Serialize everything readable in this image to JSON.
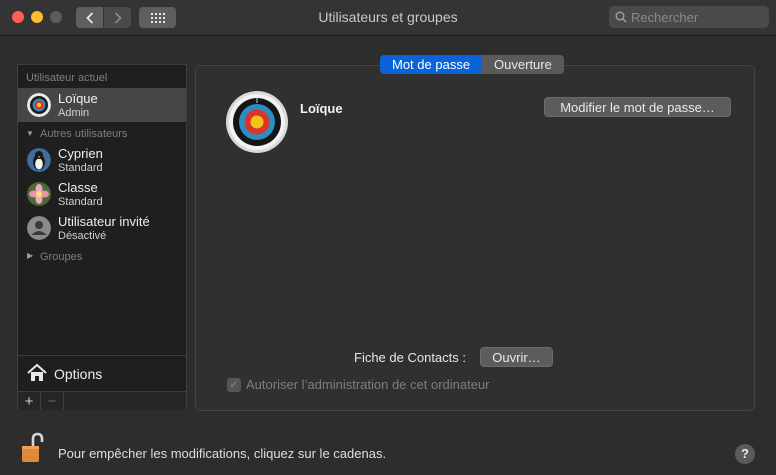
{
  "window": {
    "title": "Utilisateurs et groupes"
  },
  "toolbar": {
    "search_placeholder": "Rechercher",
    "back_icon": "chevron-left-icon",
    "forward_icon": "chevron-right-icon",
    "grid_icon": "grid-icon"
  },
  "sidebar": {
    "current_label": "Utilisateur actuel",
    "current_user": {
      "name": "Loïque",
      "role": "Admin"
    },
    "others_label": "Autres utilisateurs",
    "others": [
      {
        "name": "Cyprien",
        "role": "Standard"
      },
      {
        "name": "Classe",
        "role": "Standard"
      },
      {
        "name": "Utilisateur invité",
        "role": "Désactivé"
      }
    ],
    "groups_label": "Groupes",
    "options_label": "Options",
    "add_label": "+",
    "remove_label": "−"
  },
  "tabs": [
    {
      "label": "Mot de passe",
      "active": true
    },
    {
      "label": "Ouverture",
      "active": false
    }
  ],
  "main": {
    "user_name": "Loïque",
    "change_password_label": "Modifier le mot de passe…",
    "contacts_label": "Fiche de Contacts :",
    "open_label": "Ouvrir…",
    "admin_label": "Autoriser l’administration de cet ordinateur",
    "admin_checked": true
  },
  "footer": {
    "lock_text": "Pour empêcher les modifications, cliquez sur le cadenas.",
    "help_label": "?"
  },
  "colors": {
    "accent": "#0a63d8",
    "close": "#fe5f57",
    "minimize": "#febc2e",
    "lock": "#e0893a"
  }
}
